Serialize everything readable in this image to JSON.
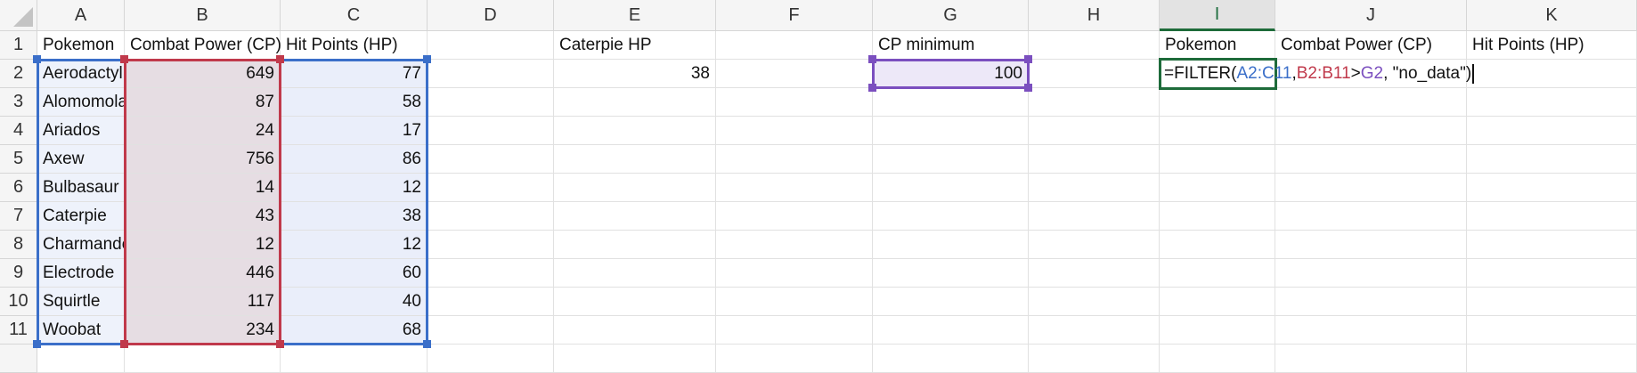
{
  "columns": [
    "A",
    "B",
    "C",
    "D",
    "E",
    "F",
    "G",
    "H",
    "I",
    "J",
    "K"
  ],
  "rows": [
    "1",
    "2",
    "3",
    "4",
    "5",
    "6",
    "7",
    "8",
    "9",
    "10",
    "11"
  ],
  "selected_column": "I",
  "cells": {
    "A1": "Pokemon",
    "B1": "Combat Power (CP)",
    "C1": "Hit Points (HP)",
    "E1": "Caterpie HP",
    "G1": "CP minimum",
    "I1": "Pokemon",
    "J1": "Combat Power (CP)",
    "K1": "Hit Points (HP)",
    "A2": "Aerodactyl",
    "B2": "649",
    "C2": "77",
    "E2": "38",
    "G2": "100",
    "A3": "Alomomola",
    "B3": "87",
    "C3": "58",
    "A4": "Ariados",
    "B4": "24",
    "C4": "17",
    "A5": "Axew",
    "B5": "756",
    "C5": "86",
    "A6": "Bulbasaur",
    "B6": "14",
    "C6": "12",
    "A7": "Caterpie",
    "B7": "43",
    "C7": "38",
    "A8": "Charmander",
    "B8": "12",
    "C8": "12",
    "A9": "Electrode",
    "B9": "446",
    "C9": "60",
    "A10": "Squirtle",
    "B10": "117",
    "C10": "40",
    "A11": "Woobat",
    "B11": "234",
    "C11": "68"
  },
  "editing_cell": "I2",
  "formula_parts": [
    {
      "text": "=FILTER(",
      "color": "#111111"
    },
    {
      "text": "A2:C11",
      "color": "#3b6fc9"
    },
    {
      "text": ",",
      "color": "#111111"
    },
    {
      "text": "B2:B11",
      "color": "#c0394b"
    },
    {
      "text": ">",
      "color": "#111111"
    },
    {
      "text": "G2",
      "color": "#7b4fbf"
    },
    {
      "text": ", \"no_data\")",
      "color": "#111111"
    }
  ],
  "range_colors": {
    "blue": "#3b6fc9",
    "red": "#c0394b",
    "purple": "#7b4fbf",
    "green": "#1e6b3a"
  }
}
